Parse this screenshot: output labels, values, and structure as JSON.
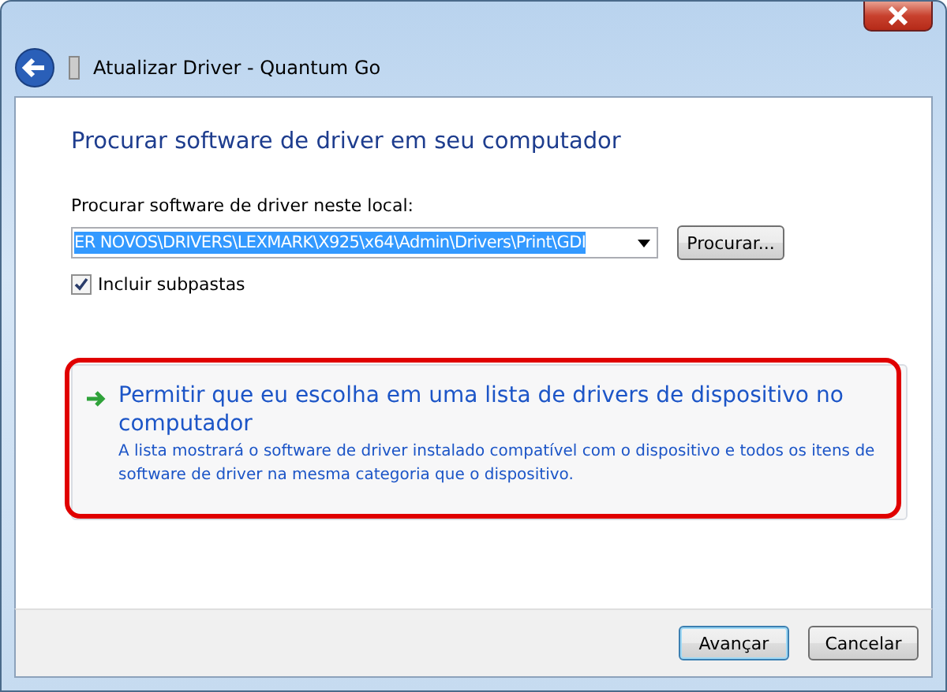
{
  "window": {
    "title": "Atualizar Driver -  Quantum Go"
  },
  "heading": "Procurar software de driver em seu computador",
  "location": {
    "label": "Procurar software de driver neste local:",
    "value": "ER NOVOS\\DRIVERS\\LEXMARK\\X925\\x64\\Admin\\Drivers\\Print\\GDI",
    "browse": "Procurar..."
  },
  "include_subfolders": {
    "label": "Incluir subpastas",
    "checked": true
  },
  "command_link": {
    "title": "Permitir que eu escolha em uma lista de drivers de dispositivo no computador",
    "description": "A lista mostrará o software de driver instalado compatível com o dispositivo e todos os itens de software de driver na mesma categoria que o dispositivo.",
    "highlighted": true
  },
  "buttons": [
    {
      "label": "Avançar",
      "default": true
    },
    {
      "label": "Cancelar",
      "default": false
    }
  ]
}
